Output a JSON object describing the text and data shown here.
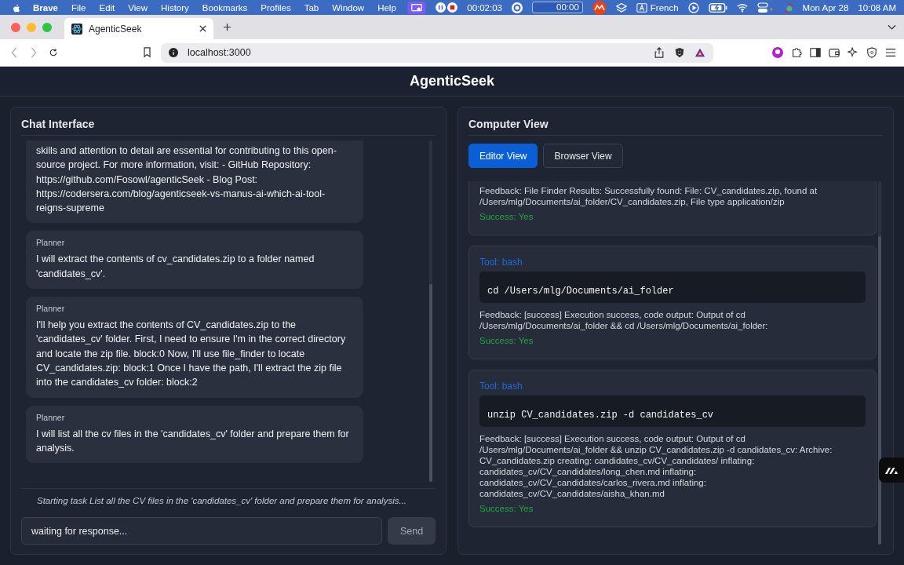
{
  "menu_bar": {
    "app": "Brave",
    "menus": [
      "File",
      "Edit",
      "View",
      "History",
      "Bookmarks",
      "Profiles",
      "Tab",
      "Window",
      "Help"
    ],
    "timer": "00:02:03",
    "counter": "00:00",
    "input_source": "French",
    "date": "Mon Apr 28",
    "time": "10:08 AM"
  },
  "browser": {
    "tabs": [
      {
        "title": "AgenticSeek",
        "selected": true
      }
    ],
    "url": "localhost:3000"
  },
  "app": {
    "title": "AgenticSeek",
    "chat": {
      "title": "Chat Interface",
      "messages": [
        {
          "text": "skills and attention to detail are essential for contributing to this open-source project. For more information, visit: - GitHub Repository: https://github.com/Fosowl/agenticSeek - Blog Post: https://codersera.com/blog/agenticseek-vs-manus-ai-which-ai-tool-reigns-supreme"
        },
        {
          "sender": "Planner",
          "text": "I will extract the contents of cv_candidates.zip to a folder named 'candidates_cv'."
        },
        {
          "sender": "Planner",
          "text": "I'll help you extract the contents of CV_candidates.zip to the 'candidates_cv' folder. First, I need to ensure I'm in the correct directory and locate the zip file. block:0 Now, I'll use file_finder to locate CV_candidates.zip: block:1 Once I have the path, I'll extract the zip file into the candidates_cv folder: block:2"
        },
        {
          "sender": "Planner",
          "text": "I will list all the cv files in the 'candidates_cv' folder and prepare them for analysis."
        }
      ],
      "status": "Starting task List all the CV files in the 'candidates_cv' folder and prepare them for analysis...",
      "input": {
        "value": "waiting for response..."
      },
      "send": {
        "label": "Send",
        "disabled": true
      }
    },
    "computer": {
      "title": "Computer View",
      "tabs": [
        {
          "label": "Editor View",
          "selected": true
        },
        {
          "label": "Browser View",
          "selected": false
        }
      ],
      "blocks": [
        {
          "feedback": "Feedback: File Finder Results: Successfully found: File: CV_candidates.zip, found at /Users/mlg/Documents/ai_folder/CV_candidates.zip, File type application/zip",
          "success": "Success: Yes"
        },
        {
          "tool": "Tool: bash",
          "command": "cd /Users/mlg/Documents/ai_folder",
          "feedback": "Feedback: [success] Execution success, code output: Output of cd /Users/mlg/Documents/ai_folder && cd /Users/mlg/Documents/ai_folder:",
          "success": "Success: Yes"
        },
        {
          "tool": "Tool: bash",
          "command": "unzip CV_candidates.zip -d candidates_cv",
          "feedback": "Feedback: [success] Execution success, code output: Output of cd /Users/mlg/Documents/ai_folder && unzip CV_candidates.zip -d candidates_cv: Archive: CV_candidates.zip creating: candidates_cv/CV_candidates/ inflating: candidates_cv/CV_candidates/long_chen.md inflating: candidates_cv/CV_candidates/carlos_rivera.md inflating: candidates_cv/CV_candidates/aisha_khan.md",
          "success": "Success: Yes"
        }
      ]
    }
  }
}
